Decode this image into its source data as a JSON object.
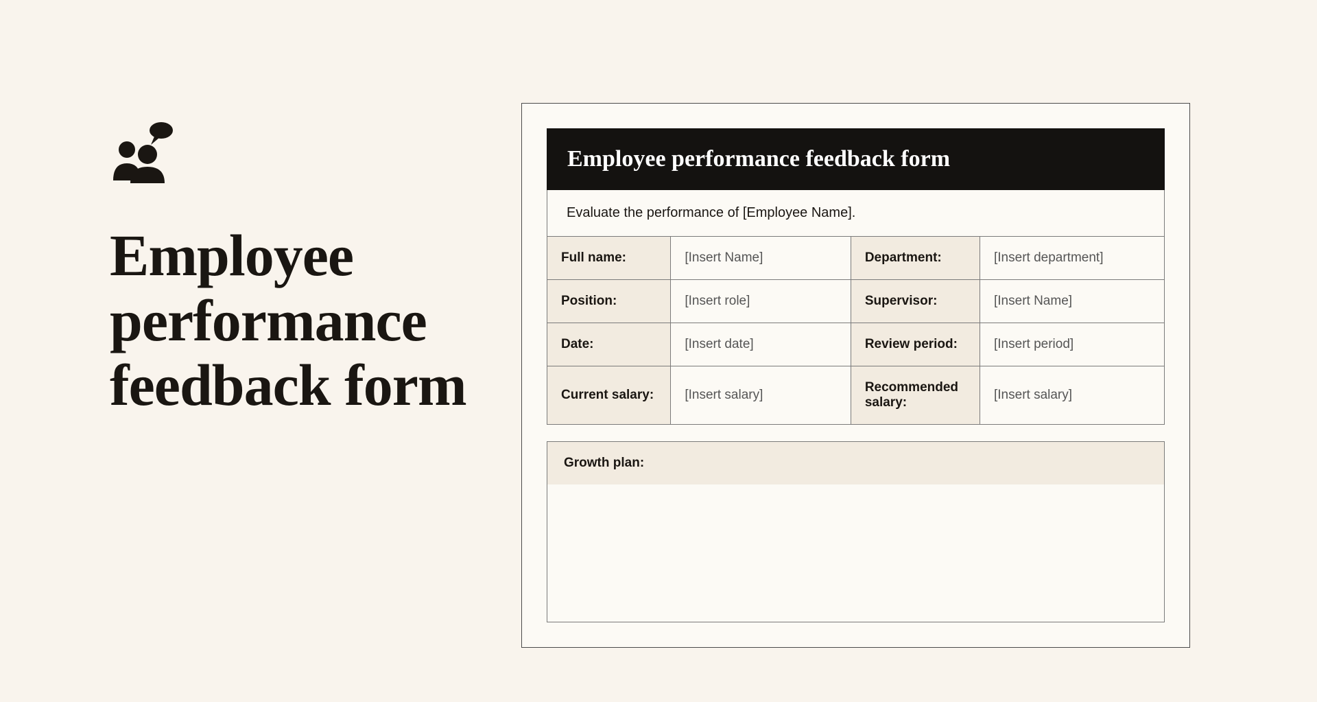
{
  "title": "Employee performance feedback form",
  "form": {
    "header": "Employee performance feedback form",
    "instruction": "Evaluate the performance of [Employee Name].",
    "fields": {
      "full_name_label": "Full name:",
      "full_name_value": "[Insert Name]",
      "department_label": "Department:",
      "department_value": "[Insert department]",
      "position_label": "Position:",
      "position_value": "[Insert role]",
      "supervisor_label": "Supervisor:",
      "supervisor_value": "[Insert Name]",
      "date_label": "Date:",
      "date_value": "[Insert date]",
      "review_period_label": "Review period:",
      "review_period_value": "[Insert period]",
      "current_salary_label": "Current salary:",
      "current_salary_value": "[Insert salary]",
      "recommended_salary_label": "Recommended salary:",
      "recommended_salary_value": "[Insert salary]"
    },
    "growth_plan_label": "Growth plan:"
  }
}
